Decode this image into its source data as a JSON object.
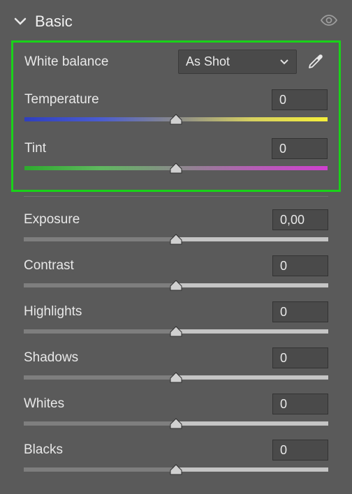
{
  "panel": {
    "title": "Basic"
  },
  "whiteBalance": {
    "label": "White balance",
    "selected": "As Shot"
  },
  "temperature": {
    "label": "Temperature",
    "value": "0"
  },
  "tint": {
    "label": "Tint",
    "value": "0"
  },
  "exposure": {
    "label": "Exposure",
    "value": "0,00"
  },
  "contrast": {
    "label": "Contrast",
    "value": "0"
  },
  "highlights": {
    "label": "Highlights",
    "value": "0"
  },
  "shadows": {
    "label": "Shadows",
    "value": "0"
  },
  "whites": {
    "label": "Whites",
    "value": "0"
  },
  "blacks": {
    "label": "Blacks",
    "value": "0"
  },
  "colors": {
    "highlight": "#19d219"
  }
}
